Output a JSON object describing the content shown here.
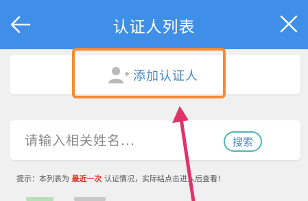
{
  "header": {
    "title": "认证人列表"
  },
  "add_card": {
    "label": "添加认证人"
  },
  "search": {
    "placeholder": "请输入相关姓名...",
    "button_label": "搜索"
  },
  "tip": {
    "prefix": "提示：本列表为",
    "highlight": "最近一次",
    "middle": "认证情况，实际结",
    "suffix": "点击进入后查看！"
  },
  "colors": {
    "header_bg": "#3f8fe8",
    "highlight_box": "#f28c3a",
    "arrow": "#e0336a",
    "tip_highlight": "#e0332b",
    "search_btn_border": "#4eb7b0"
  },
  "icons": [
    "back-arrow-icon",
    "close-icon",
    "add-user-icon"
  ]
}
